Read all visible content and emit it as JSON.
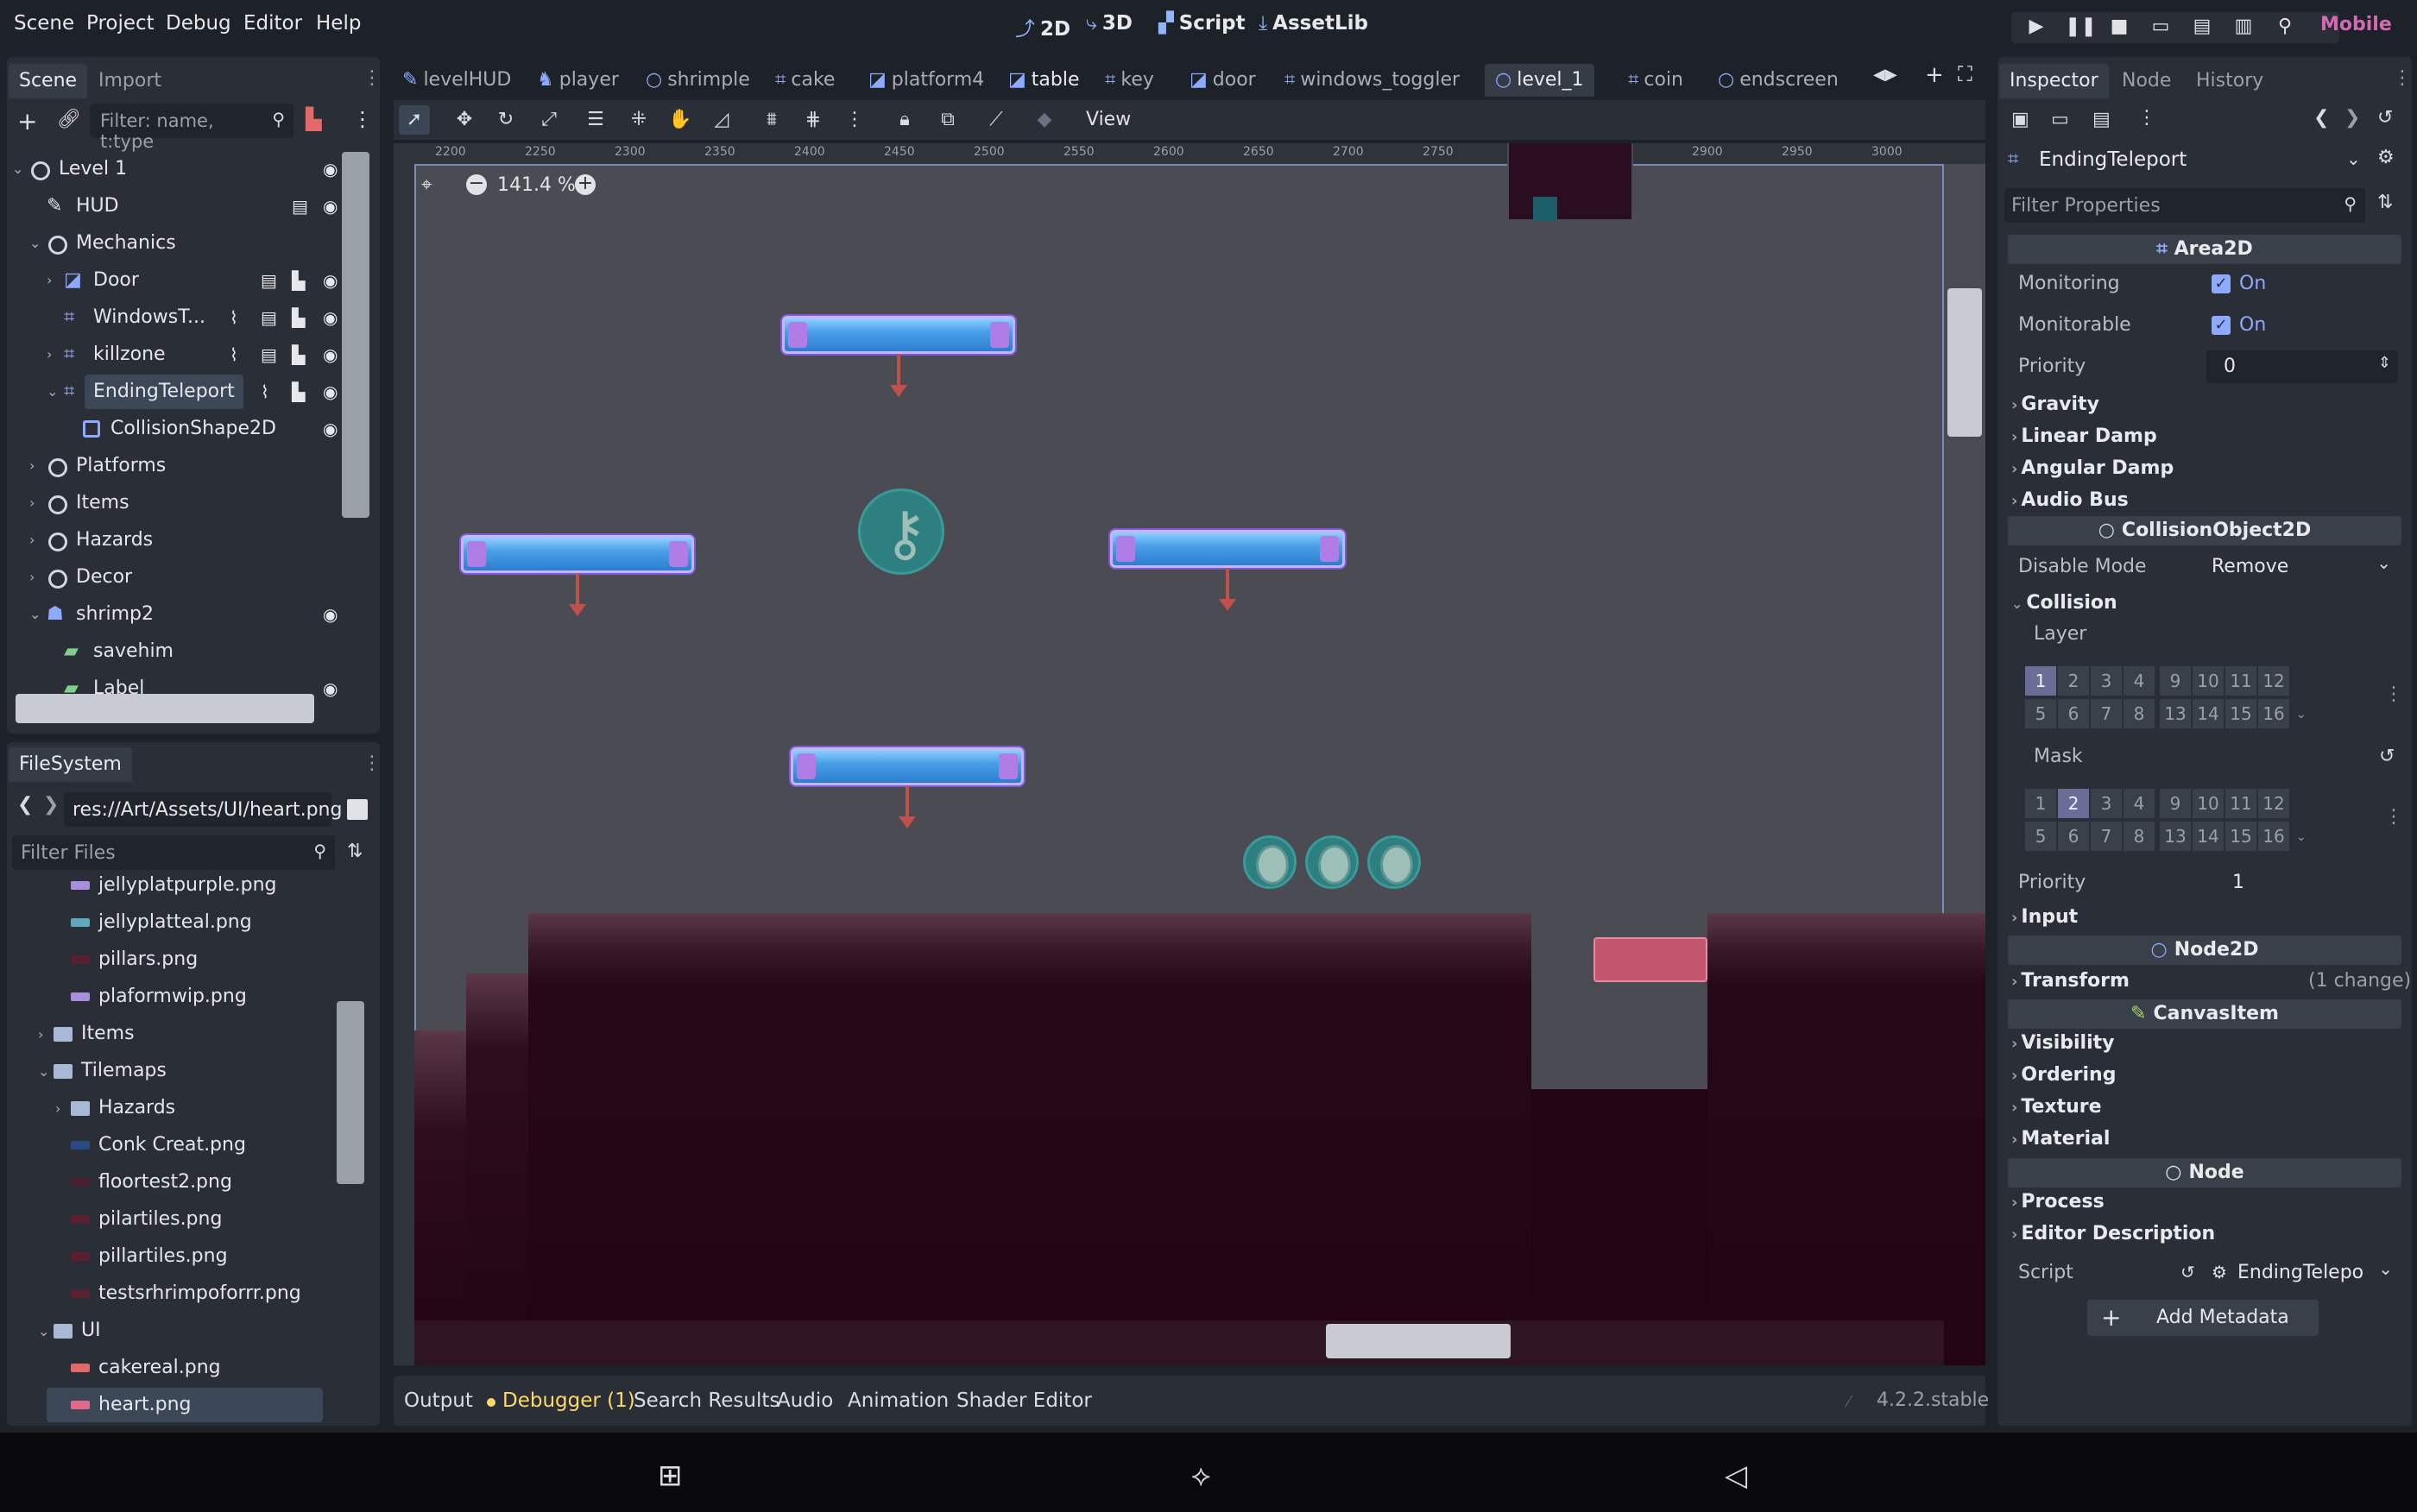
{
  "menu": [
    "Scene",
    "Project",
    "Debug",
    "Editor",
    "Help"
  ],
  "workspaces": [
    {
      "label": "2D",
      "glyph": "⤴",
      "active": true
    },
    {
      "label": "3D",
      "glyph": "⤷"
    },
    {
      "label": "Script",
      "glyph": "▞"
    },
    {
      "label": "AssetLib",
      "glyph": "⤓"
    }
  ],
  "renderer": "Mobile",
  "scene_dock": {
    "tabs": [
      "Scene",
      "Import"
    ],
    "filter_placeholder": "Filter: name, t:type",
    "tree": [
      {
        "label": "Level 1",
        "indent": 0,
        "expanded": true,
        "icon": "node2d-icon",
        "eye": true
      },
      {
        "label": "HUD",
        "indent": 1,
        "icon": "edit-icon",
        "eye": true,
        "scene": true
      },
      {
        "label": "Mechanics",
        "indent": 1,
        "expanded": true,
        "icon": "node2d-icon"
      },
      {
        "label": "Door",
        "indent": 2,
        "collapsed": true,
        "icon": "door-icon",
        "eye": true,
        "scene": true,
        "script": true
      },
      {
        "label": "WindowsT...",
        "indent": 2,
        "icon": "area2d-icon",
        "eye": true,
        "signal": true,
        "scene": true,
        "script": true
      },
      {
        "label": "killzone",
        "indent": 2,
        "collapsed": true,
        "icon": "area2d-icon",
        "eye": true,
        "signal": true,
        "scene": true,
        "script": true
      },
      {
        "label": "EndingTeleport",
        "indent": 2,
        "expanded": true,
        "icon": "area2d-icon",
        "eye": true,
        "signal": true,
        "script": true,
        "selected": true
      },
      {
        "label": "CollisionShape2D",
        "indent": 3,
        "icon": "collision-icon",
        "eye": true
      },
      {
        "label": "Platforms",
        "indent": 1,
        "collapsed": true,
        "icon": "node2d-icon"
      },
      {
        "label": "Items",
        "indent": 1,
        "collapsed": true,
        "icon": "node2d-icon"
      },
      {
        "label": "Hazards",
        "indent": 1,
        "collapsed": true,
        "icon": "node2d-icon"
      },
      {
        "label": "Decor",
        "indent": 1,
        "collapsed": true,
        "icon": "node2d-icon"
      },
      {
        "label": "shrimp2",
        "indent": 1,
        "expanded": true,
        "icon": "character-icon",
        "eye": true
      },
      {
        "label": "savehim",
        "indent": 2,
        "icon": "label-icon"
      },
      {
        "label": "Label",
        "indent": 2,
        "icon": "label-icon",
        "eye": true
      }
    ]
  },
  "filesystem": {
    "tab": "FileSystem",
    "path": "res://Art/Assets/UI/heart.png",
    "filter_placeholder": "Filter Files",
    "items": [
      {
        "label": "jellyplatpurple.png",
        "indent": 2,
        "kind": "purple"
      },
      {
        "label": "jellyplatteal.png",
        "indent": 2,
        "kind": "teal"
      },
      {
        "label": "pillars.png",
        "indent": 2,
        "kind": "pillar"
      },
      {
        "label": "plaformwip.png",
        "indent": 2,
        "kind": "purple"
      },
      {
        "label": "Items",
        "indent": 1,
        "kind": "folder",
        "collapsed": true
      },
      {
        "label": "Tilemaps",
        "indent": 1,
        "kind": "folder",
        "expanded": true
      },
      {
        "label": "Hazards",
        "indent": 2,
        "kind": "folder",
        "collapsed": true
      },
      {
        "label": "Conk Creat.png",
        "indent": 2,
        "kind": "blue"
      },
      {
        "label": "floortest2.png",
        "indent": 2,
        "kind": "dark"
      },
      {
        "label": "pilartiles.png",
        "indent": 2,
        "kind": "pillar"
      },
      {
        "label": "pillartiles.png",
        "indent": 2,
        "kind": "pillar"
      },
      {
        "label": "testsrhrimpoforrr.png",
        "indent": 2,
        "kind": "pillar"
      },
      {
        "label": "UI",
        "indent": 1,
        "kind": "folder",
        "expanded": true
      },
      {
        "label": "cakereal.png",
        "indent": 2,
        "kind": "cake"
      },
      {
        "label": "heart.png",
        "indent": 2,
        "kind": "heart",
        "selected": true
      }
    ]
  },
  "editor_tabs": [
    {
      "label": "levelHUD",
      "icon": "✎"
    },
    {
      "label": "player",
      "icon": "♞"
    },
    {
      "label": "shrimple",
      "icon": "○"
    },
    {
      "label": "cake",
      "icon": "⌗"
    },
    {
      "label": "platform4",
      "icon": "◪"
    },
    {
      "label": "table",
      "icon": "◪",
      "bright": true
    },
    {
      "label": "key",
      "icon": "⌗"
    },
    {
      "label": "door",
      "icon": "◪"
    },
    {
      "label": "windows_toggler",
      "icon": "⌗"
    },
    {
      "label": "level_1",
      "icon": "○",
      "active": true
    },
    {
      "label": "coin",
      "icon": "⌗"
    },
    {
      "label": "endscreen",
      "icon": "○"
    }
  ],
  "viewport": {
    "zoom": "141.4 %",
    "view_menu": "View",
    "ruler_marks": [
      "2200",
      "2250",
      "2300",
      "2350",
      "2400",
      "2450",
      "2500",
      "2550",
      "2600",
      "2650",
      "2700",
      "2750",
      "2800",
      "2850",
      "2900",
      "2950",
      "3000"
    ]
  },
  "inspector": {
    "tabs": [
      "Inspector",
      "Node",
      "History"
    ],
    "node_name": "EndingTeleport",
    "filter_placeholder": "Filter Properties",
    "sections": {
      "area2d": "Area2D",
      "collision_object": "CollisionObject2D",
      "node2d": "Node2D",
      "canvas_item": "CanvasItem",
      "node": "Node"
    },
    "monitoring": {
      "label": "Monitoring",
      "value": "On"
    },
    "monitorable": {
      "label": "Monitorable",
      "value": "On"
    },
    "priority": {
      "label": "Priority",
      "value": "0"
    },
    "area_categories": [
      "Gravity",
      "Linear Damp",
      "Angular Damp",
      "Audio Bus"
    ],
    "disable_mode": {
      "label": "Disable Mode",
      "value": "Remove"
    },
    "collision": "Collision",
    "layer": {
      "label": "Layer",
      "rows": [
        [
          "1",
          "2",
          "3",
          "4",
          "9",
          "10",
          "11",
          "12"
        ],
        [
          "5",
          "6",
          "7",
          "8",
          "13",
          "14",
          "15",
          "16"
        ]
      ],
      "active": "1"
    },
    "mask": {
      "label": "Mask",
      "rows": [
        [
          "1",
          "2",
          "3",
          "4",
          "9",
          "10",
          "11",
          "12"
        ],
        [
          "5",
          "6",
          "7",
          "8",
          "13",
          "14",
          "15",
          "16"
        ]
      ],
      "active": "2"
    },
    "collision_priority": {
      "label": "Priority",
      "value": "1"
    },
    "input": "Input",
    "transform": {
      "label": "Transform",
      "note": "(1 change)"
    },
    "canvas_categories": [
      "Visibility",
      "Ordering",
      "Texture",
      "Material"
    ],
    "node_categories": [
      "Process",
      "Editor Description"
    ],
    "script": {
      "label": "Script",
      "value": "EndingTelepo"
    },
    "add_metadata": "Add Metadata"
  },
  "bottom_panel": {
    "tabs": [
      "Output",
      "Debugger (1)",
      "Search Results",
      "Audio",
      "Animation",
      "Shader Editor"
    ],
    "version": "4.2.2.stable"
  },
  "colors": {
    "accent": "#8eaaff",
    "warning": "#ffd86a",
    "renderer": "#d46ab2"
  }
}
